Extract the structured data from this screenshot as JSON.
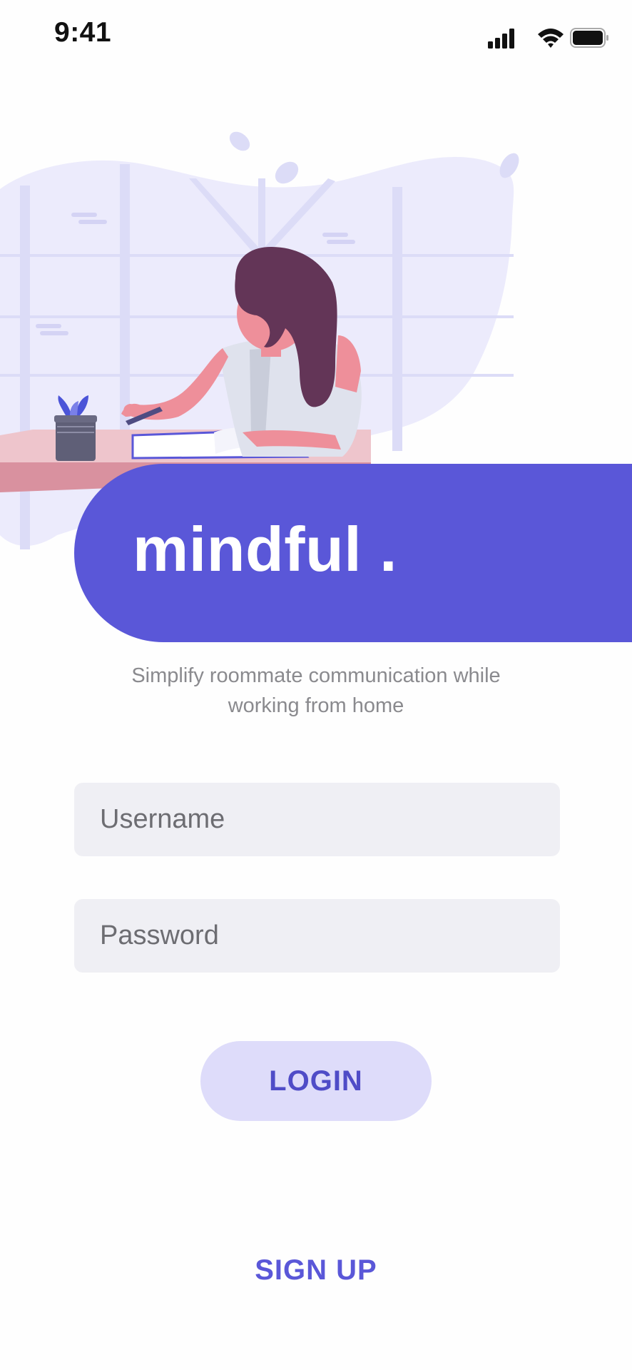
{
  "status_bar": {
    "time": "9:41",
    "signal_icon": "cellular-signal-icon",
    "wifi_icon": "wifi-icon",
    "battery_icon": "battery-icon"
  },
  "illustration": {
    "icon": "woman-writing-at-desk-illustration"
  },
  "brand": {
    "title": "mindful .",
    "accent_color": "#5a57d8"
  },
  "tagline": "Simplify roommate communication while working from home",
  "form": {
    "username_placeholder": "Username",
    "password_placeholder": "Password",
    "username_value": "",
    "password_value": ""
  },
  "actions": {
    "login_label": "LOGIN",
    "signup_label": "SIGN UP"
  },
  "colors": {
    "primary": "#5a57d8",
    "button_bg": "#dedcfa",
    "field_bg": "#efeff4",
    "text_muted": "#8a8a8e"
  }
}
